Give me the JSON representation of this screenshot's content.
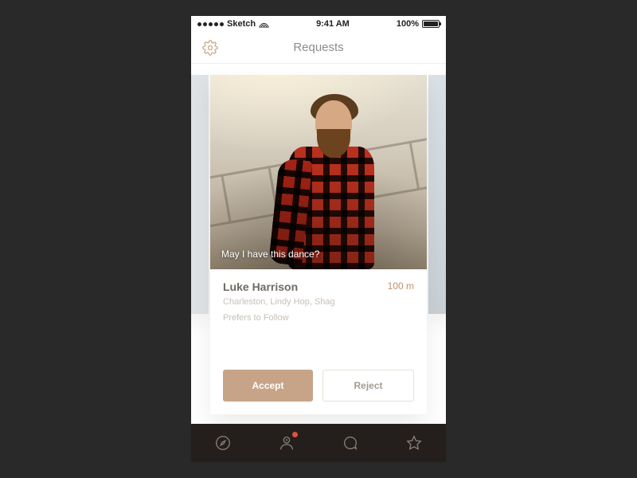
{
  "statusbar": {
    "carrier": "Sketch",
    "time": "9:41 AM",
    "battery": "100%"
  },
  "header": {
    "title": "Requests"
  },
  "card": {
    "caption": "May I have this dance?",
    "name": "Luke Harrison",
    "distance": "100 m",
    "styles": "Charleston, Lindy Hop, Shag",
    "role": "Prefers to Follow",
    "accept_label": "Accept",
    "reject_label": "Reject"
  },
  "nav": {
    "items": [
      {
        "icon": "compass-icon",
        "badge": false
      },
      {
        "icon": "requests-icon",
        "badge": true
      },
      {
        "icon": "chat-icon",
        "badge": false
      },
      {
        "icon": "star-icon",
        "badge": false
      }
    ]
  },
  "colors": {
    "accent": "#c7a487",
    "badge": "#e0513e",
    "nav_bg": "#241f1c"
  }
}
